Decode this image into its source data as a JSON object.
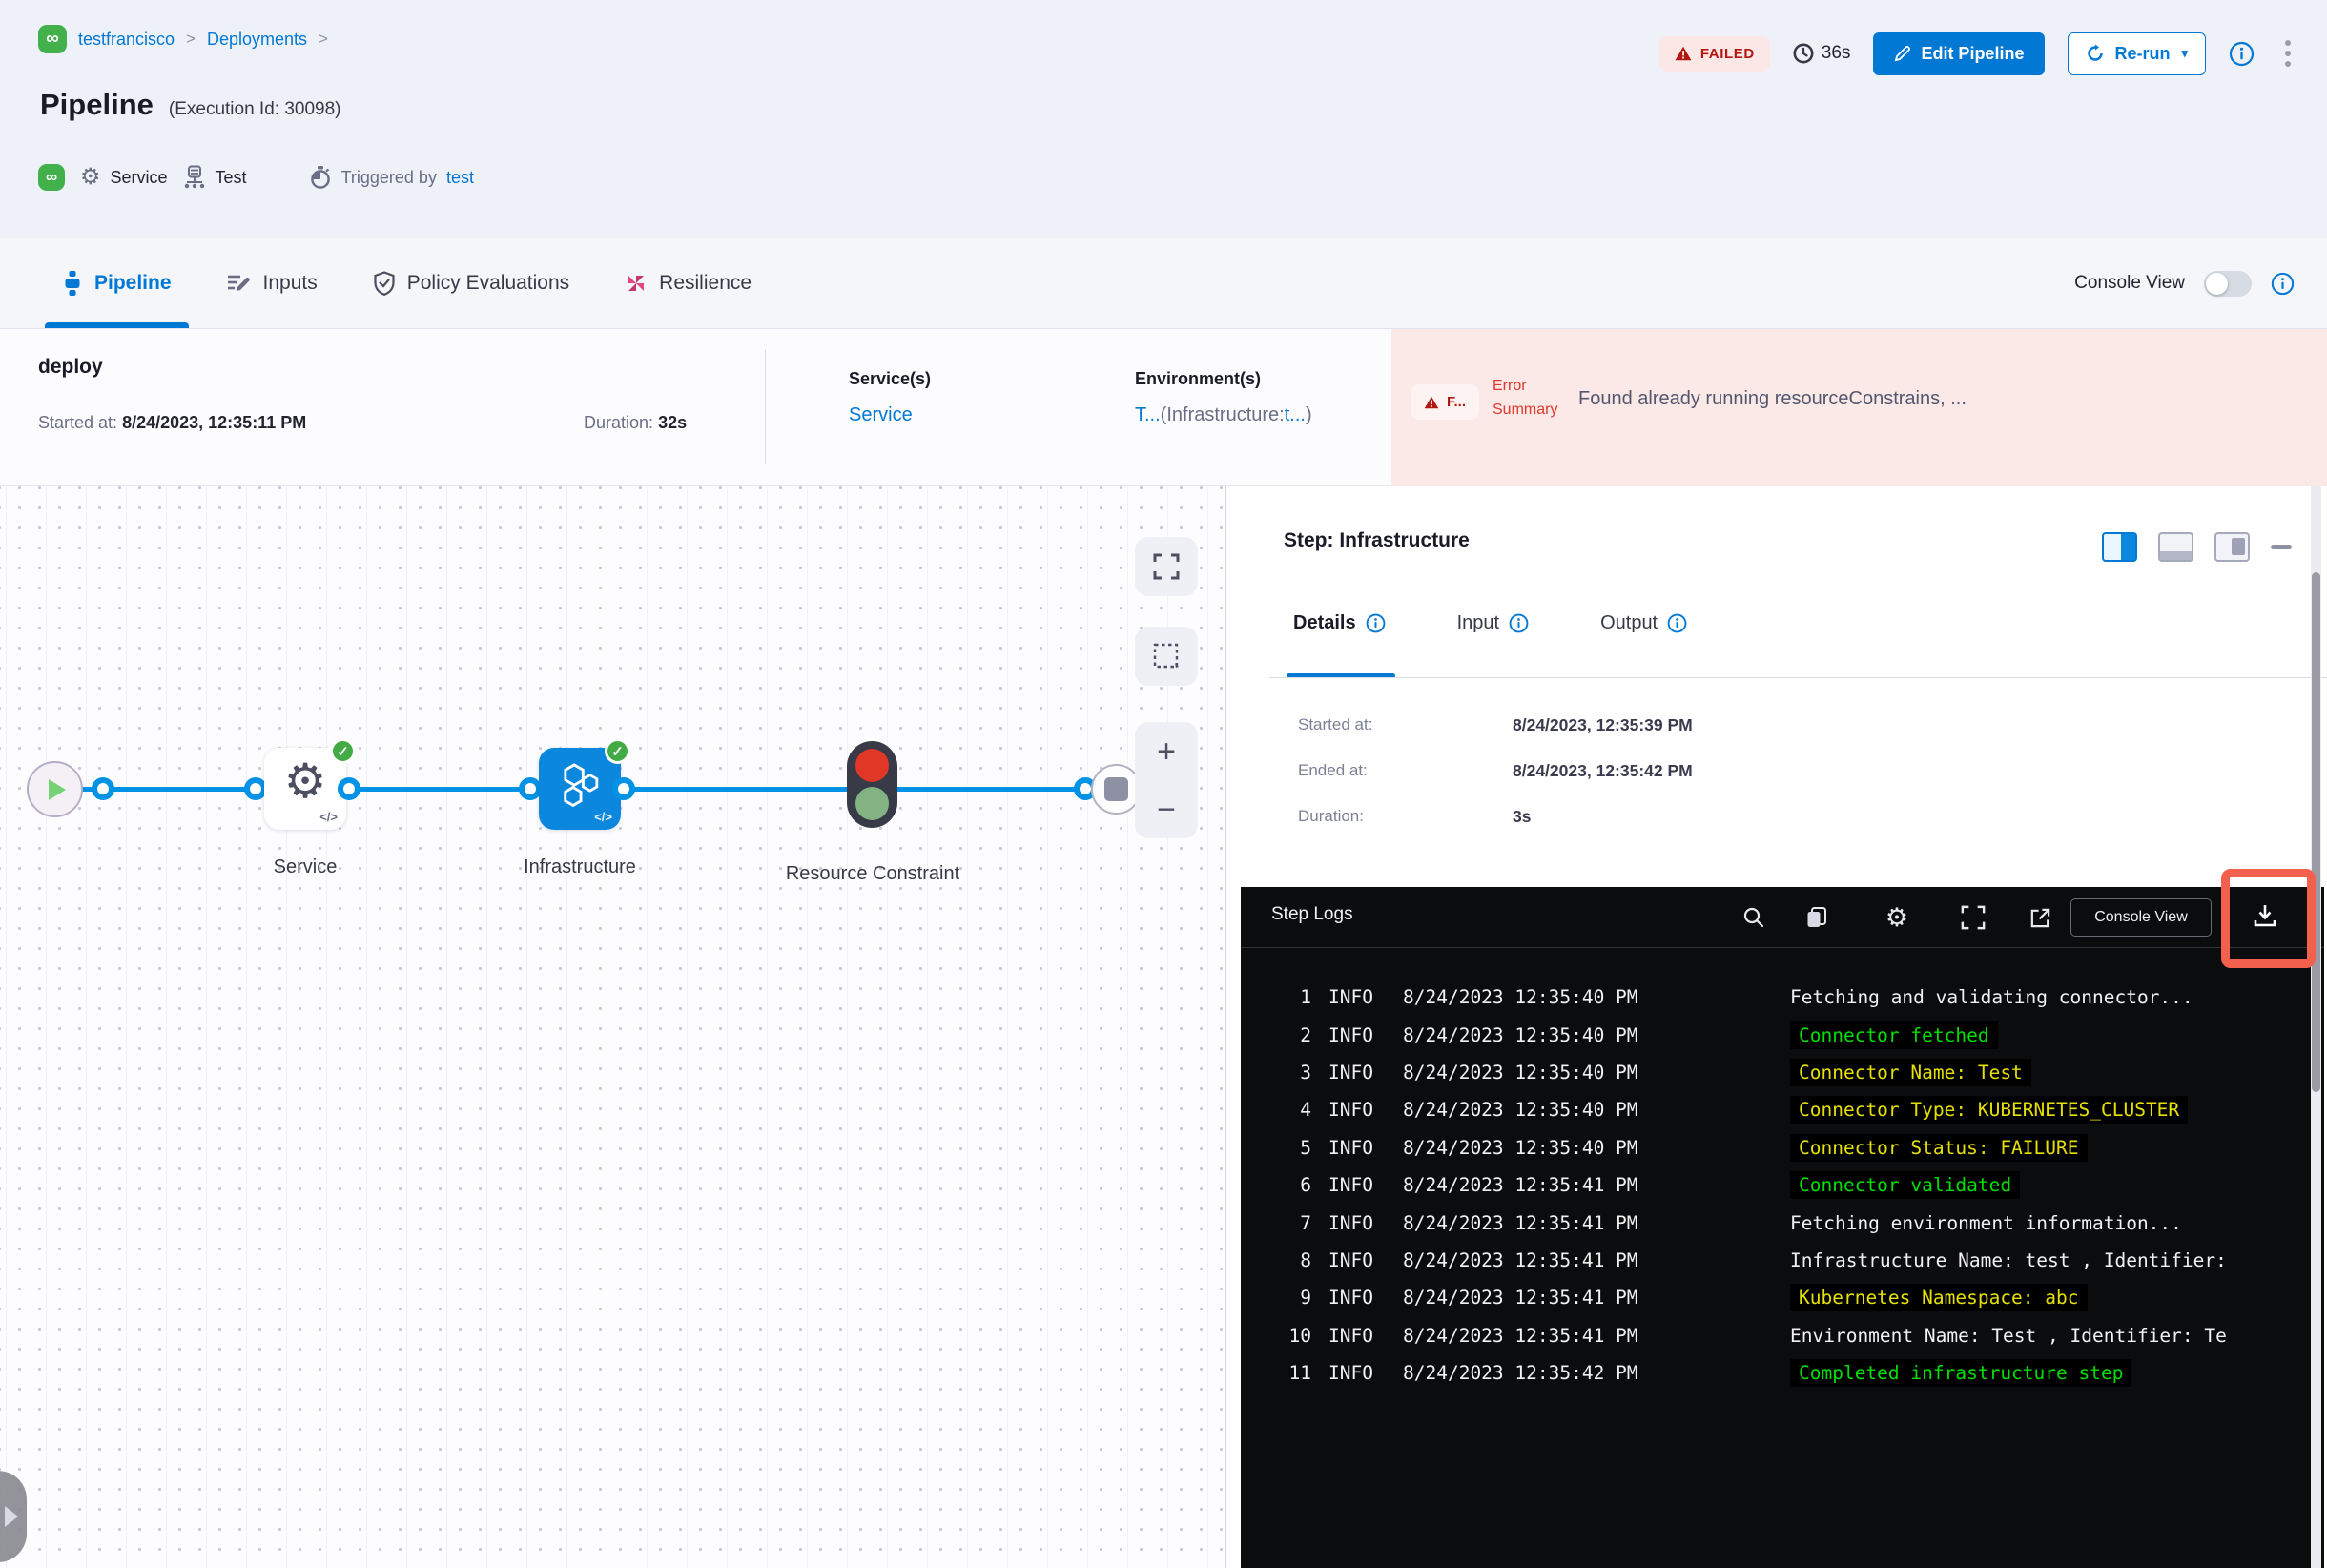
{
  "colors": {
    "primary_blue": "#0278d5",
    "failed_red": "#b41710",
    "error_text_red": "#e0382b",
    "node_blue": "#0b87de",
    "success_green": "#42ab45",
    "log_green": "#00e000",
    "log_yellow": "#e5e000",
    "annotation_red": "#f4604e"
  },
  "icons": {
    "infinity": "∞",
    "gear": "⚙",
    "kebab": "⋮",
    "caret_down": "▾",
    "check": "✓",
    "code": "</>",
    "plus": "+",
    "minus": "−",
    "chevron": ">"
  },
  "breadcrumb": {
    "project": "testfrancisco",
    "section": "Deployments"
  },
  "header": {
    "title": "Pipeline",
    "subtitle": "(Execution Id: 30098)",
    "status": "FAILED",
    "elapsed": "36s",
    "edit_button": "Edit Pipeline",
    "rerun_button": "Re-run",
    "service_label": "Service",
    "test_label": "Test",
    "triggered_by_label": "Triggered by",
    "triggered_by_user": "test"
  },
  "tabs": {
    "pipeline": "Pipeline",
    "inputs": "Inputs",
    "policy": "Policy Evaluations",
    "resilience": "Resilience",
    "console_view_label": "Console View"
  },
  "stage": {
    "name": "deploy",
    "started_label": "Started at:",
    "started": "8/24/2023, 12:35:11 PM",
    "duration_label": "Duration:",
    "duration": "32s",
    "services_label": "Service(s)",
    "service_link": "Service",
    "environments_label": "Environment(s)",
    "env_link1": "T...",
    "env_mid": "(Infrastructure:",
    "env_link2": "t...",
    "env_close": ")",
    "error_badge": "F...",
    "error_label": "Error Summary",
    "error_message": "Found already running resourceConstrains, ..."
  },
  "graph": {
    "nodes": [
      {
        "label": "Service"
      },
      {
        "label": "Infrastructure"
      },
      {
        "label": "Resource Constraint"
      }
    ]
  },
  "step_panel": {
    "title": "Step: Infrastructure",
    "tab_details": "Details",
    "tab_input": "Input",
    "tab_output": "Output",
    "started_label": "Started at:",
    "started": "8/24/2023, 12:35:39 PM",
    "ended_label": "Ended at:",
    "ended": "8/24/2023, 12:35:42 PM",
    "duration_label": "Duration:",
    "duration": "3s"
  },
  "logs": {
    "title": "Step Logs",
    "console_view_button": "Console View",
    "lines": [
      {
        "num": "1",
        "level": "INFO",
        "time": "8/24/2023 12:35:40 PM",
        "message": "Fetching and validating connector..."
      },
      {
        "num": "2",
        "level": "INFO",
        "time": "8/24/2023 12:35:40 PM",
        "message": "Connector fetched"
      },
      {
        "num": "3",
        "level": "INFO",
        "time": "8/24/2023 12:35:40 PM",
        "message": "Connector Name: Test"
      },
      {
        "num": "4",
        "level": "INFO",
        "time": "8/24/2023 12:35:40 PM",
        "message": "Connector Type: KUBERNETES_CLUSTER"
      },
      {
        "num": "5",
        "level": "INFO",
        "time": "8/24/2023 12:35:40 PM",
        "message": "Connector Status: FAILURE"
      },
      {
        "num": "6",
        "level": "INFO",
        "time": "8/24/2023 12:35:41 PM",
        "message": "Connector validated"
      },
      {
        "num": "7",
        "level": "INFO",
        "time": "8/24/2023 12:35:41 PM",
        "message": "Fetching environment information..."
      },
      {
        "num": "8",
        "level": "INFO",
        "time": "8/24/2023 12:35:41 PM",
        "message": "Infrastructure Name: test , Identifier:"
      },
      {
        "num": "9",
        "level": "INFO",
        "time": "8/24/2023 12:35:41 PM",
        "message": "Kubernetes Namespace: abc"
      },
      {
        "num": "10",
        "level": "INFO",
        "time": "8/24/2023 12:35:41 PM",
        "message": "Environment Name: Test , Identifier: Te"
      },
      {
        "num": "11",
        "level": "INFO",
        "time": "8/24/2023 12:35:42 PM",
        "message": "Completed infrastructure step"
      }
    ]
  }
}
